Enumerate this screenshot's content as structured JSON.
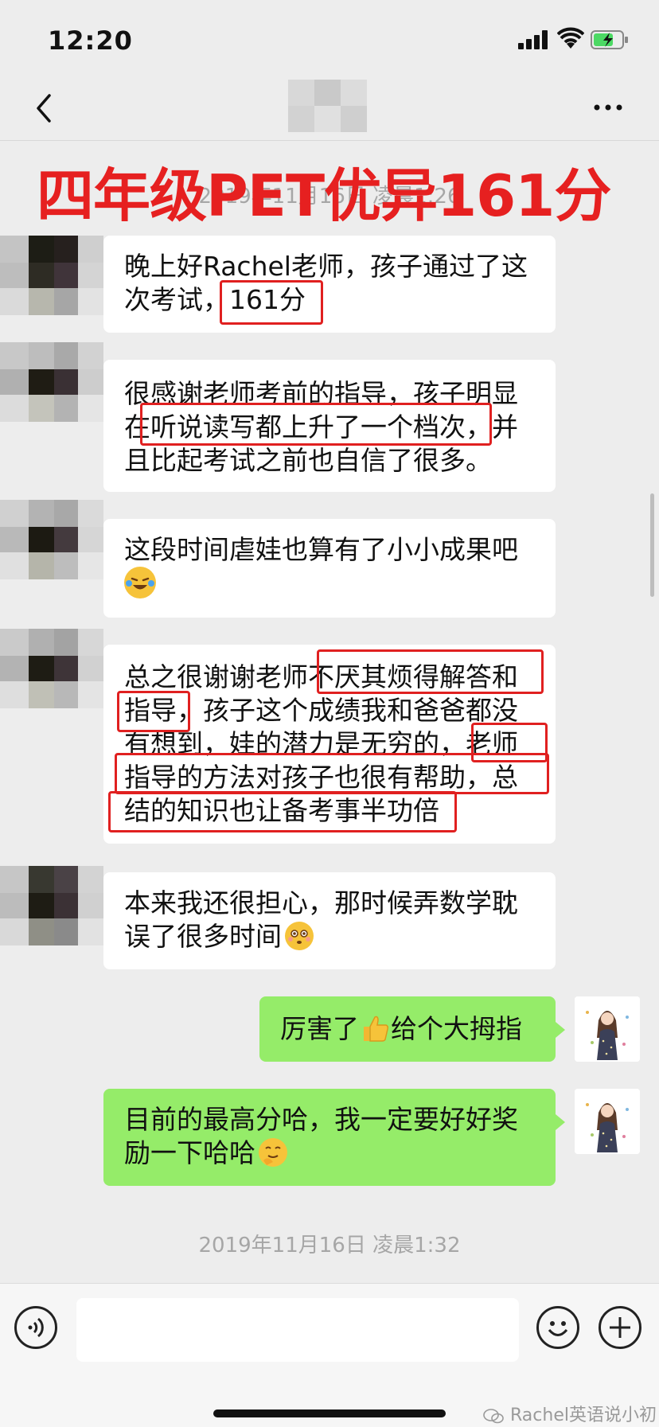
{
  "status_bar": {
    "time": "12:20"
  },
  "overlay_title": "四年级PET优异161分",
  "timestamps": {
    "top": "2019年11月16日 凌晨1:26",
    "bottom": "2019年11月16日 凌晨1:32"
  },
  "messages": [
    {
      "side": "left",
      "lines": [
        "晚上好Rachel老师，孩子通过了这",
        "次考试，161分"
      ]
    },
    {
      "side": "left",
      "lines": [
        "很感谢老师考前的指导，孩子明显",
        "在听说读写都上升了一个档次，并",
        "且比起考试之前也自信了很多。"
      ]
    },
    {
      "side": "left",
      "lines": [
        "这段时间虐娃也算有了小小成果吧"
      ],
      "emoji": "laughing-crying"
    },
    {
      "side": "left",
      "lines": [
        "总之很谢谢老师不厌其烦得解答和",
        "指导，孩子这个成绩我和爸爸都没",
        "有想到，娃的潜力是无穷的，老师",
        "指导的方法对孩子也很有帮助，总",
        "结的知识也让备考事半功倍"
      ]
    },
    {
      "side": "left",
      "lines": [
        "本来我还很担心，那时候弄数学耽",
        "误了很多时间"
      ],
      "emoji": "worried-face"
    },
    {
      "side": "right",
      "text_before": "厉害了",
      "text_after": "给个大拇指",
      "emoji": "thumbs-up"
    },
    {
      "side": "right",
      "lines": [
        "目前的最高分哈，我一定要好好奖",
        "励一下哈哈"
      ],
      "emoji": "thinking-face"
    }
  ],
  "watermark": "Rachel英语说小初",
  "colors": {
    "highlight": "#e02020",
    "bubble_right": "#95ec69",
    "bubble_left": "#ffffff",
    "background": "#ededed"
  },
  "icons": {
    "back": "chevron-left-icon",
    "more": "more-dots-icon",
    "voice": "voice-icon",
    "emoji": "smiley-icon",
    "plus": "plus-icon"
  }
}
